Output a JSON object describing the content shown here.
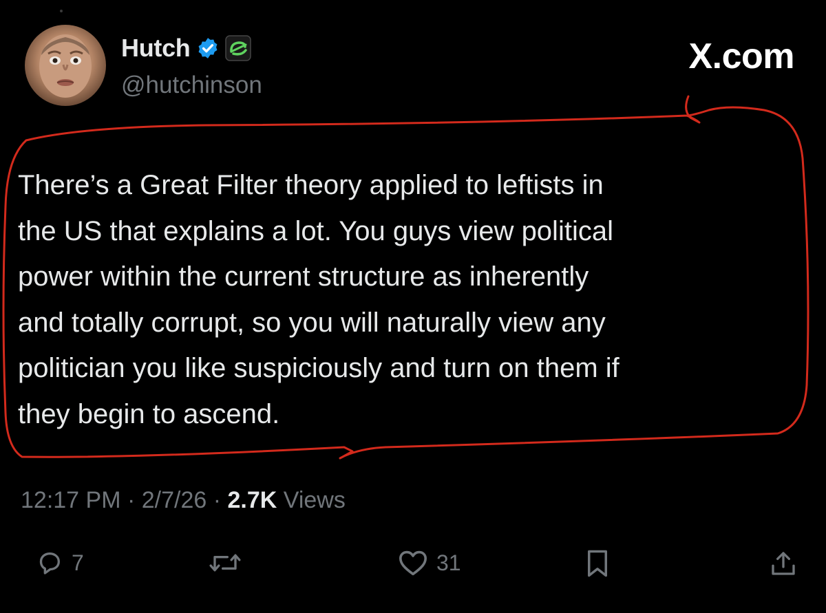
{
  "author": {
    "display_name": "Hutch",
    "handle": "@hutchinson",
    "verified_icon": "verified-badge-icon",
    "affiliation_icon": "optic-gaming-logo-icon"
  },
  "brand_label": "X.com",
  "tweet": {
    "text": "There’s a Great Filter theory applied to leftists in\nthe US that explains a lot. You guys view political\npower within the current structure as inherently\nand totally corrupt, so you will naturally view any\npolitician you like suspiciously and turn on them if\nthey begin to ascend."
  },
  "meta": {
    "time": "12:17 PM",
    "separator": " · ",
    "date": "2/7/26",
    "views_count": "2.7K",
    "views_label": "Views"
  },
  "actions": {
    "reply_count": "7",
    "repost_count": "",
    "like_count": "31",
    "reply_icon": "reply-icon",
    "repost_icon": "repost-icon",
    "like_icon": "heart-icon",
    "bookmark_icon": "bookmark-icon",
    "share_icon": "share-icon"
  },
  "colors": {
    "background": "#000000",
    "primary_text": "#e7e9ea",
    "secondary_text": "#71767b",
    "verified_blue": "#1d9bf0",
    "affiliation_green": "#5fd35f",
    "annotation_red": "#d32a1c"
  }
}
